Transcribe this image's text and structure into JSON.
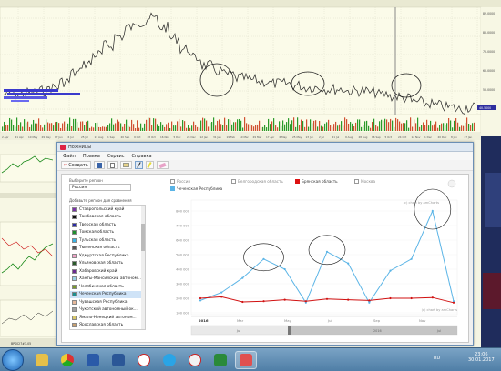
{
  "background_chart": {
    "price_labels": [
      "89.0000",
      "80.0000",
      "70.0000",
      "60.0000",
      "50.0000",
      "40.5000"
    ],
    "bottom_labels": [
      "2 Apr",
      "21 Apr",
      "10 May",
      "29 May",
      "17 Jun",
      "6 Jul",
      "25 Jul",
      "13 Aug",
      "1 Sep",
      "20 Sep",
      "9 Oct",
      "28 Oct",
      "16 Nov",
      "5 Dec",
      "24 Dec",
      "12 Jan",
      "31 Jan",
      "19 Feb",
      "10 Mar",
      "29 Mar",
      "17 Apr",
      "6 May",
      "25 May",
      "13 Jun",
      "2 Jul",
      "21 Jul",
      "9 Aug",
      "28 Aug",
      "16 Sep",
      "5 Oct",
      "24 Oct",
      "12 Nov",
      "1 Dec",
      "20 Dec",
      "8 Jan",
      "27 Jan"
    ],
    "price_tag": "40.5000",
    "bottom_status": "BPS027#3-05"
  },
  "window": {
    "title": "Ножницы",
    "menu": [
      "Файл",
      "Правка",
      "Сервис",
      "Справка"
    ],
    "toolbar": {
      "new_label": "Создать"
    }
  },
  "region_panel": {
    "select_label": "Выберите регион",
    "select_value": "Россия",
    "add_label": "Добавьте регион для сравнения",
    "items": [
      {
        "name": "Ставропольский край",
        "color": "#7b32a8"
      },
      {
        "name": "Тамбовская область",
        "color": "#111111"
      },
      {
        "name": "Тверская область",
        "color": "#2a2aa8"
      },
      {
        "name": "Томская область",
        "color": "#1f8f2e"
      },
      {
        "name": "Тульская область",
        "color": "#39b4e6"
      },
      {
        "name": "Тюменская область",
        "color": "#555555"
      },
      {
        "name": "Удмуртская Республика",
        "color": "#f0a3c8"
      },
      {
        "name": "Ульяновская область",
        "color": "#2a5a2a"
      },
      {
        "name": "Хабаровский край",
        "color": "#6b2a8f"
      },
      {
        "name": "Ханты-Мансийский автоном...",
        "color": "#9ad2e6"
      },
      {
        "name": "Челябинская область",
        "color": "#7a9a2a"
      },
      {
        "name": "Чеченская Республика",
        "color": "#1f8f8f",
        "selected": true
      },
      {
        "name": "Чувашская Республика",
        "color": "#e6b89a"
      },
      {
        "name": "Чукотский автономный ок...",
        "color": "#a0a0a0"
      },
      {
        "name": "Ямало-Ненецкий автоном...",
        "color": "#d8c86a"
      },
      {
        "name": "Ярославская область",
        "color": "#c8a070"
      }
    ]
  },
  "legend": [
    {
      "name": "Россия",
      "state": "off"
    },
    {
      "name": "Чеченская Республика",
      "state": "blue"
    },
    {
      "name": "Белгородская область",
      "state": "off"
    },
    {
      "name": "Брянская область",
      "state": "red"
    },
    {
      "name": "Москва",
      "state": "off"
    }
  ],
  "chart_data": {
    "type": "line",
    "ylabels": [
      "800 000",
      "700 000",
      "600 000",
      "500 000",
      "400 000",
      "300 000",
      "200 000",
      "100 000"
    ],
    "ylim": [
      100000,
      850000
    ],
    "xlabels": [
      "2016",
      "Mar",
      "May",
      "Jul",
      "Sep",
      "Nov"
    ],
    "x": [
      0,
      1,
      2,
      3,
      4,
      5,
      6,
      7,
      8,
      9,
      10,
      11
    ],
    "series": [
      {
        "name": "Чеченская Республика",
        "color": "#5ab4e6",
        "values": [
          185000,
          240000,
          340000,
          470000,
          400000,
          170000,
          520000,
          440000,
          170000,
          390000,
          470000,
          800000,
          180000
        ]
      },
      {
        "name": "Брянская область",
        "color": "#d11111",
        "values": [
          200000,
          210000,
          175000,
          180000,
          190000,
          180000,
          195000,
          190000,
          185000,
          200000,
          200000,
          205000,
          170000
        ]
      }
    ],
    "credit": "(c) chart by amCharts",
    "navigator_labels": [
      "Jul",
      "2016",
      "Jul"
    ]
  },
  "taskbar": {
    "lang": "RU",
    "time": "23:06",
    "date": "30.01.2017"
  }
}
